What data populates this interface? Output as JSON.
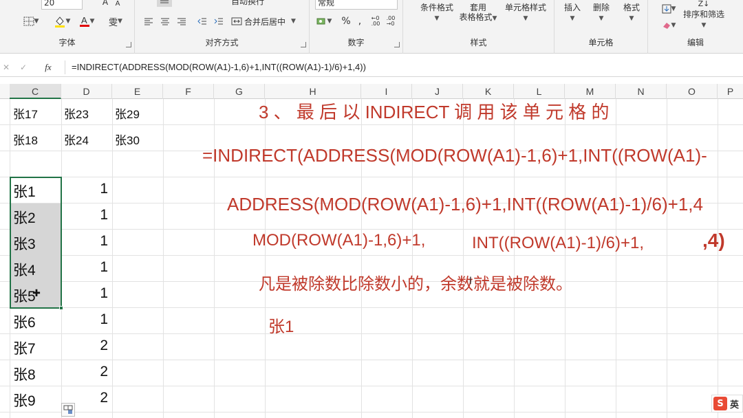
{
  "ribbon": {
    "font_size_value": "20",
    "font_group": "字体",
    "align_group": "对齐方式",
    "wrap_label": "自动换行",
    "merge_label": "合并后居中",
    "number_group": "数字",
    "number_format": "常规",
    "percent": "%",
    "comma": ",",
    "styles_group": "样式",
    "cond_format": "条件格式",
    "table_format_1": "套用",
    "table_format_2": "表格格式",
    "cell_styles": "单元格样式",
    "cells_group": "单元格",
    "insert": "插入",
    "delete": "删除",
    "format": "格式",
    "sort_filter": "排序和筛选",
    "edit_group": "编辑"
  },
  "formula_bar": {
    "fx": "fx",
    "formula": "=INDIRECT(ADDRESS(MOD(ROW(A1)-1,6)+1,INT((ROW(A1)-1)/6)+1,4))"
  },
  "columns": [
    "C",
    "D",
    "E",
    "F",
    "G",
    "H",
    "I",
    "J",
    "K",
    "L",
    "M",
    "N",
    "O",
    "P"
  ],
  "top_rows": [
    {
      "c": "张17",
      "d": "张23",
      "e": "张29"
    },
    {
      "c": "张18",
      "d": "张24",
      "e": "张30"
    }
  ],
  "list_rows": [
    {
      "c": "张1",
      "d": "1"
    },
    {
      "c": "张2",
      "d": "1"
    },
    {
      "c": "张3",
      "d": "1"
    },
    {
      "c": "张4",
      "d": "1"
    },
    {
      "c": "张5",
      "d": "1"
    },
    {
      "c": "张6",
      "d": "1"
    },
    {
      "c": "张7",
      "d": "2"
    },
    {
      "c": "张8",
      "d": "2"
    },
    {
      "c": "张9",
      "d": "2"
    }
  ],
  "annotations": {
    "step_title": "3 、 最 后 以   INDIRECT   调 用 该 单 元 格 的",
    "formula_full": "=INDIRECT(ADDRESS(MOD(ROW(A1)-1,6)+1,INT((ROW(A1)-",
    "formula_address": "ADDRESS(MOD(ROW(A1)-1,6)+1,INT((ROW(A1)-1)/6)+1,4",
    "formula_mod": "MOD(ROW(A1)-1,6)+1,",
    "formula_int": "INT((ROW(A1)-1)/6)+1,",
    "formula_4": ",4)",
    "explanation": "凡是被除数比除数小的，余数就是被除数。",
    "result": "张1"
  },
  "ime": {
    "label": "英",
    "logo": "S"
  },
  "colors": {
    "annotation_red": "#c0392b",
    "selection_green": "#217346"
  }
}
